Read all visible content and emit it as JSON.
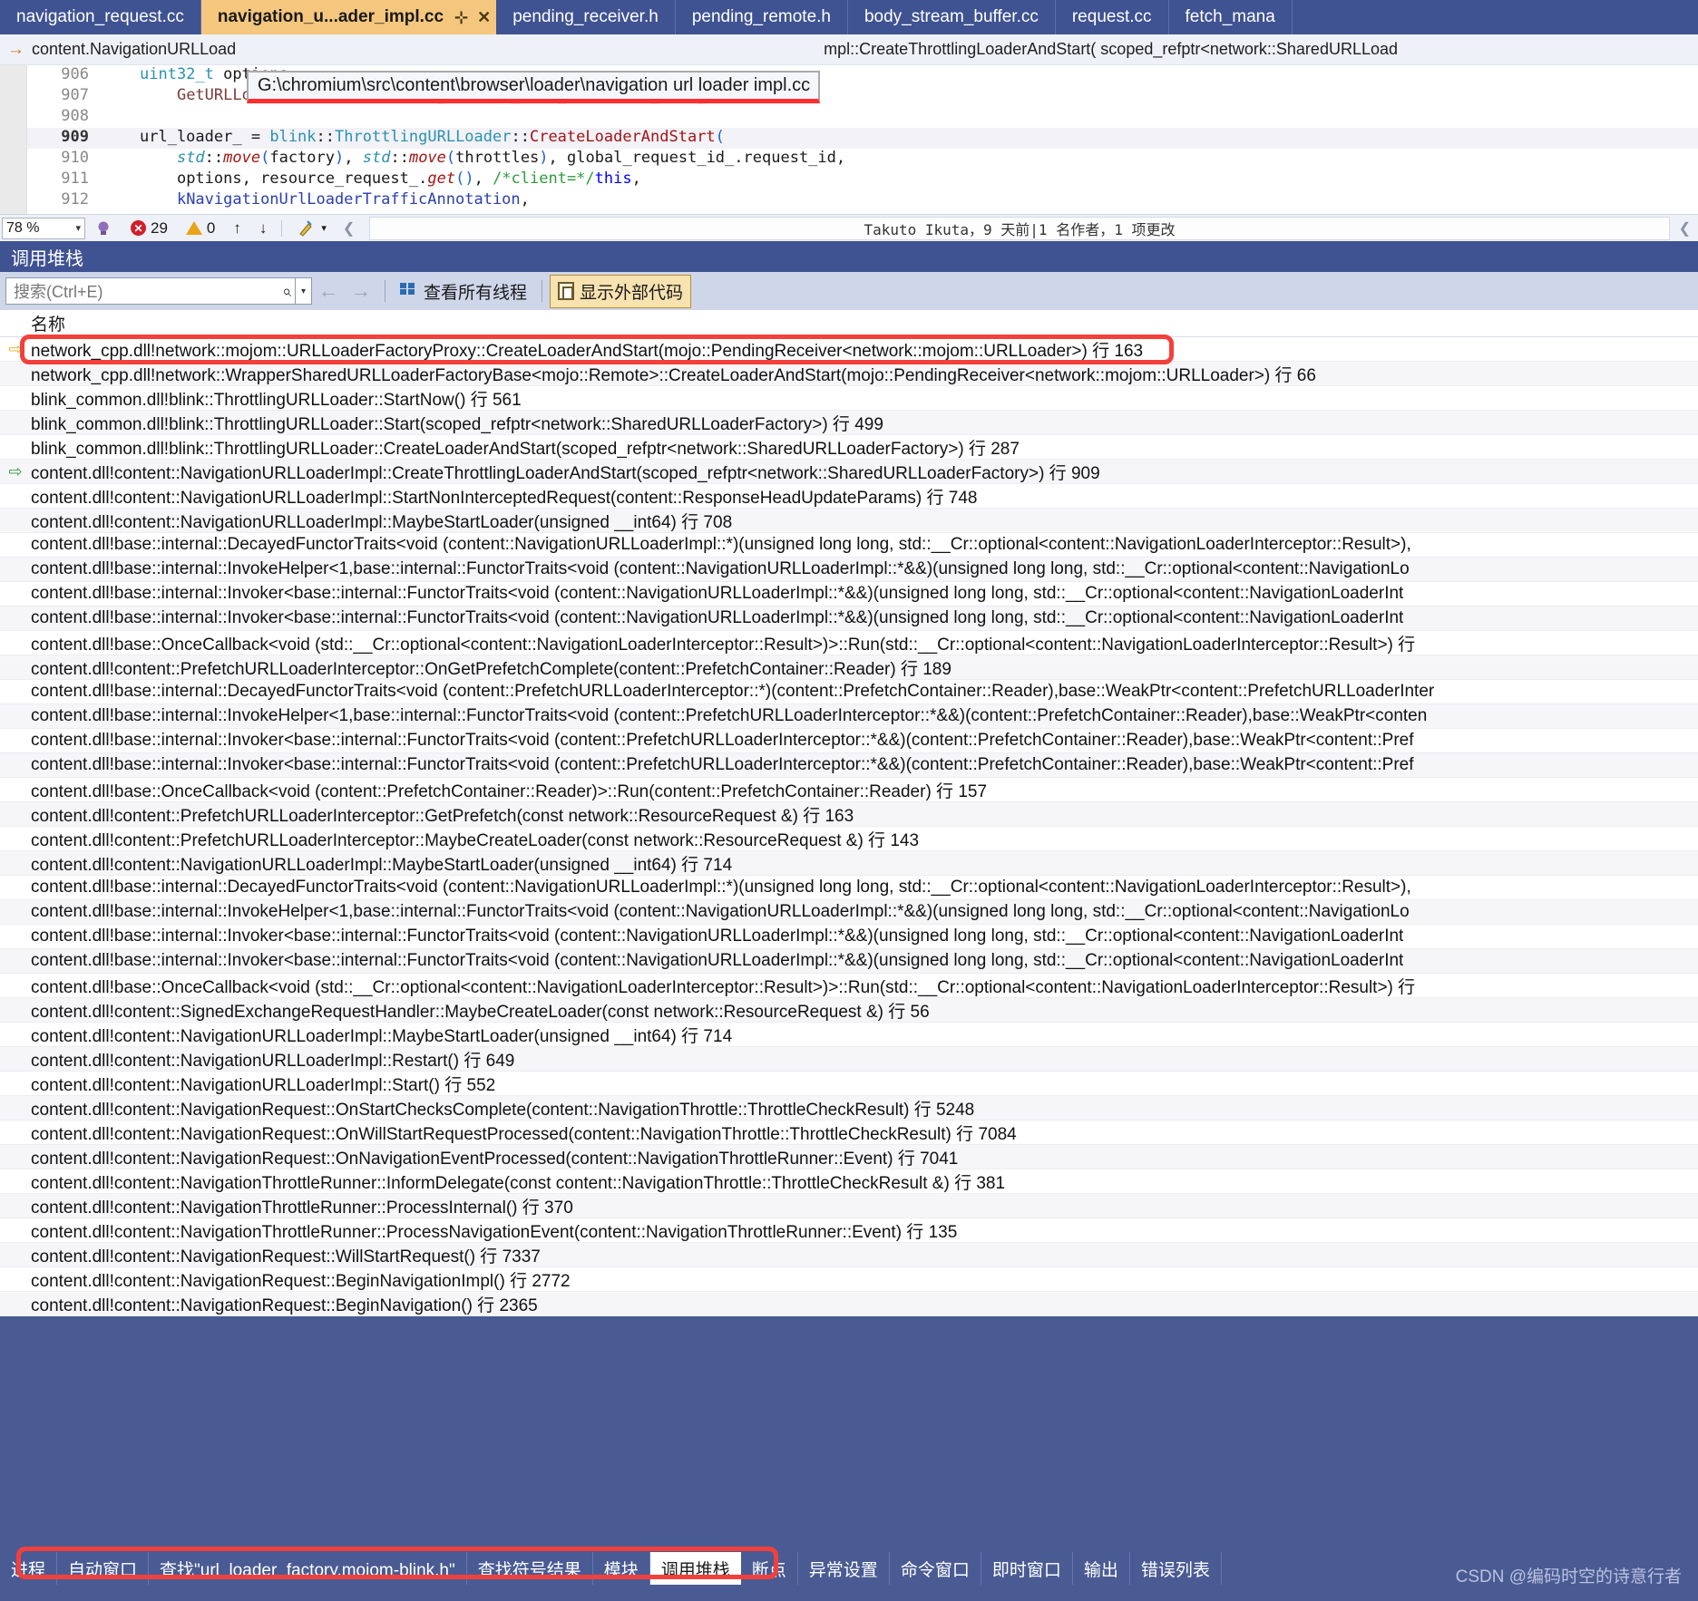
{
  "editor": {
    "tabs": [
      {
        "label": "navigation_request.cc",
        "active": false
      },
      {
        "label": "navigation_u...ader_impl.cc",
        "active": true,
        "pin": "⊹",
        "close": "✕"
      },
      {
        "label": "pending_receiver.h",
        "active": false
      },
      {
        "label": "pending_remote.h",
        "active": false
      },
      {
        "label": "body_stream_buffer.cc",
        "active": false
      },
      {
        "label": "request.cc",
        "active": false
      },
      {
        "label": "fetch_mana",
        "active": false
      }
    ],
    "navbar": {
      "arrow_icon": "→",
      "left_text": "content.NavigationURLLoad",
      "right_text": "mpl::CreateThrottlingLoaderAndStart( scoped_refptr<network::SharedURLLoad"
    },
    "tooltip": {
      "path": "G:\\chromium\\src\\content\\browser\\loader\\navigation url loader impl.cc"
    },
    "lines": [
      {
        "num": "906",
        "marker": "",
        "current": false
      },
      {
        "num": "907",
        "marker": "",
        "current": false
      },
      {
        "num": "908",
        "marker": "",
        "current": false
      },
      {
        "num": "909",
        "marker": "⇨",
        "current": true
      },
      {
        "num": "910",
        "marker": "",
        "current": false
      },
      {
        "num": "911",
        "marker": "",
        "current": false
      },
      {
        "num": "912",
        "marker": "",
        "current": false
      }
    ],
    "status": {
      "zoom": "78 %",
      "zoom_caret": "▾",
      "error_icon": "✕",
      "error_count": "29",
      "warning_count": "0",
      "up_arrow": "↑",
      "down_arrow": "↓",
      "brush_caret": "▾",
      "chev_left": "❮",
      "chev_right": "❮",
      "author": "Takuto Ikuta，9 天前|1 名作者，1 项更改"
    }
  },
  "callstack": {
    "title": "调用堆栈",
    "toolbar": {
      "search_placeholder": "搜索(Ctrl+E)",
      "search_value": "",
      "search_icon": "⌕",
      "dropdown_caret": "▾",
      "back_arrow": "←",
      "forward_arrow": "→",
      "all_threads_label": "查看所有线程",
      "external_code_label": "显示外部代码"
    },
    "column_header": "名称",
    "rows": [
      {
        "marker": "current",
        "text": "network_cpp.dll!network::mojom::URLLoaderFactoryProxy::CreateLoaderAndStart(mojo::PendingReceiver<network::mojom::URLLoader>) 行 163"
      },
      {
        "marker": "",
        "text": "network_cpp.dll!network::WrapperSharedURLLoaderFactoryBase<mojo::Remote>::CreateLoaderAndStart(mojo::PendingReceiver<network::mojom::URLLoader>) 行 66"
      },
      {
        "marker": "",
        "text": "blink_common.dll!blink::ThrottlingURLLoader::StartNow() 行 561"
      },
      {
        "marker": "",
        "text": "blink_common.dll!blink::ThrottlingURLLoader::Start(scoped_refptr<network::SharedURLLoaderFactory>) 行 499"
      },
      {
        "marker": "",
        "text": "blink_common.dll!blink::ThrottlingURLLoader::CreateLoaderAndStart(scoped_refptr<network::SharedURLLoaderFactory>) 行 287"
      },
      {
        "marker": "green",
        "text": "content.dll!content::NavigationURLLoaderImpl::CreateThrottlingLoaderAndStart(scoped_refptr<network::SharedURLLoaderFactory>) 行 909"
      },
      {
        "marker": "",
        "text": "content.dll!content::NavigationURLLoaderImpl::StartNonInterceptedRequest(content::ResponseHeadUpdateParams) 行 748"
      },
      {
        "marker": "",
        "text": "content.dll!content::NavigationURLLoaderImpl::MaybeStartLoader(unsigned __int64) 行 708"
      },
      {
        "marker": "",
        "text": "content.dll!base::internal::DecayedFunctorTraits<void (content::NavigationURLLoaderImpl::*)(unsigned long long, std::__Cr::optional<content::NavigationLoaderInterceptor::Result>),"
      },
      {
        "marker": "",
        "text": "content.dll!base::internal::InvokeHelper<1,base::internal::FunctorTraits<void (content::NavigationURLLoaderImpl::*&&)(unsigned long long, std::__Cr::optional<content::NavigationLo"
      },
      {
        "marker": "",
        "text": "content.dll!base::internal::Invoker<base::internal::FunctorTraits<void (content::NavigationURLLoaderImpl::*&&)(unsigned long long, std::__Cr::optional<content::NavigationLoaderInt"
      },
      {
        "marker": "",
        "text": "content.dll!base::internal::Invoker<base::internal::FunctorTraits<void (content::NavigationURLLoaderImpl::*&&)(unsigned long long, std::__Cr::optional<content::NavigationLoaderInt"
      },
      {
        "marker": "",
        "text": "content.dll!base::OnceCallback<void (std::__Cr::optional<content::NavigationLoaderInterceptor::Result>)>::Run(std::__Cr::optional<content::NavigationLoaderInterceptor::Result>) 行"
      },
      {
        "marker": "",
        "text": "content.dll!content::PrefetchURLLoaderInterceptor::OnGetPrefetchComplete(content::PrefetchContainer::Reader) 行 189"
      },
      {
        "marker": "",
        "text": "content.dll!base::internal::DecayedFunctorTraits<void (content::PrefetchURLLoaderInterceptor::*)(content::PrefetchContainer::Reader),base::WeakPtr<content::PrefetchURLLoaderInter"
      },
      {
        "marker": "",
        "text": "content.dll!base::internal::InvokeHelper<1,base::internal::FunctorTraits<void (content::PrefetchURLLoaderInterceptor::*&&)(content::PrefetchContainer::Reader),base::WeakPtr<conten"
      },
      {
        "marker": "",
        "text": "content.dll!base::internal::Invoker<base::internal::FunctorTraits<void (content::PrefetchURLLoaderInterceptor::*&&)(content::PrefetchContainer::Reader),base::WeakPtr<content::Pref"
      },
      {
        "marker": "",
        "text": "content.dll!base::internal::Invoker<base::internal::FunctorTraits<void (content::PrefetchURLLoaderInterceptor::*&&)(content::PrefetchContainer::Reader),base::WeakPtr<content::Pref"
      },
      {
        "marker": "",
        "text": "content.dll!base::OnceCallback<void (content::PrefetchContainer::Reader)>::Run(content::PrefetchContainer::Reader) 行 157"
      },
      {
        "marker": "",
        "text": "content.dll!content::PrefetchURLLoaderInterceptor::GetPrefetch(const network::ResourceRequest &) 行 163"
      },
      {
        "marker": "",
        "text": "content.dll!content::PrefetchURLLoaderInterceptor::MaybeCreateLoader(const network::ResourceRequest &) 行 143"
      },
      {
        "marker": "",
        "text": "content.dll!content::NavigationURLLoaderImpl::MaybeStartLoader(unsigned __int64) 行 714"
      },
      {
        "marker": "",
        "text": "content.dll!base::internal::DecayedFunctorTraits<void (content::NavigationURLLoaderImpl::*)(unsigned long long, std::__Cr::optional<content::NavigationLoaderInterceptor::Result>),"
      },
      {
        "marker": "",
        "text": "content.dll!base::internal::InvokeHelper<1,base::internal::FunctorTraits<void (content::NavigationURLLoaderImpl::*&&)(unsigned long long, std::__Cr::optional<content::NavigationLo"
      },
      {
        "marker": "",
        "text": "content.dll!base::internal::Invoker<base::internal::FunctorTraits<void (content::NavigationURLLoaderImpl::*&&)(unsigned long long, std::__Cr::optional<content::NavigationLoaderInt"
      },
      {
        "marker": "",
        "text": "content.dll!base::internal::Invoker<base::internal::FunctorTraits<void (content::NavigationURLLoaderImpl::*&&)(unsigned long long, std::__Cr::optional<content::NavigationLoaderInt"
      },
      {
        "marker": "",
        "text": "content.dll!base::OnceCallback<void (std::__Cr::optional<content::NavigationLoaderInterceptor::Result>)>::Run(std::__Cr::optional<content::NavigationLoaderInterceptor::Result>) 行"
      },
      {
        "marker": "",
        "text": "content.dll!content::SignedExchangeRequestHandler::MaybeCreateLoader(const network::ResourceRequest &) 行 56"
      },
      {
        "marker": "",
        "text": "content.dll!content::NavigationURLLoaderImpl::MaybeStartLoader(unsigned __int64) 行 714"
      },
      {
        "marker": "",
        "text": "content.dll!content::NavigationURLLoaderImpl::Restart() 行 649"
      },
      {
        "marker": "",
        "text": "content.dll!content::NavigationURLLoaderImpl::Start() 行 552"
      },
      {
        "marker": "",
        "text": "content.dll!content::NavigationRequest::OnStartChecksComplete(content::NavigationThrottle::ThrottleCheckResult) 行 5248"
      },
      {
        "marker": "",
        "text": "content.dll!content::NavigationRequest::OnWillStartRequestProcessed(content::NavigationThrottle::ThrottleCheckResult) 行 7084"
      },
      {
        "marker": "",
        "text": "content.dll!content::NavigationRequest::OnNavigationEventProcessed(content::NavigationThrottleRunner::Event) 行 7041"
      },
      {
        "marker": "",
        "text": "content.dll!content::NavigationThrottleRunner::InformDelegate(const content::NavigationThrottle::ThrottleCheckResult &) 行 381"
      },
      {
        "marker": "",
        "text": "content.dll!content::NavigationThrottleRunner::ProcessInternal() 行 370"
      },
      {
        "marker": "",
        "text": "content.dll!content::NavigationThrottleRunner::ProcessNavigationEvent(content::NavigationThrottleRunner::Event) 行 135"
      },
      {
        "marker": "",
        "text": "content.dll!content::NavigationRequest::WillStartRequest() 行 7337"
      },
      {
        "marker": "",
        "text": "content.dll!content::NavigationRequest::BeginNavigationImpl() 行 2772"
      },
      {
        "marker": "",
        "text": "content.dll!content::NavigationRequest::BeginNavigation() 行 2365"
      }
    ]
  },
  "bottom_tabs": [
    {
      "label": "进程",
      "active": false
    },
    {
      "label": "自动窗口",
      "active": false
    },
    {
      "label": "查找\"url_loader_factory.mojom-blink.h\"",
      "active": false
    },
    {
      "label": "查找符号结果",
      "active": false
    },
    {
      "label": "模块",
      "active": false
    },
    {
      "label": "调用堆栈",
      "active": true
    },
    {
      "label": "断点",
      "active": false
    },
    {
      "label": "异常设置",
      "active": false
    },
    {
      "label": "命令窗口",
      "active": false
    },
    {
      "label": "即时窗口",
      "active": false
    },
    {
      "label": "输出",
      "active": false
    },
    {
      "label": "错误列表",
      "active": false
    }
  ],
  "watermark": "CSDN @编码时空的诗意行者",
  "colors": {
    "accent_blue": "#3f5291",
    "tab_active": "#f5c77e",
    "annotation_red": "#f4403a",
    "error_red": "#d01f2b",
    "warn_orange": "#e8a317",
    "green_marker": "#2f9b3a"
  }
}
